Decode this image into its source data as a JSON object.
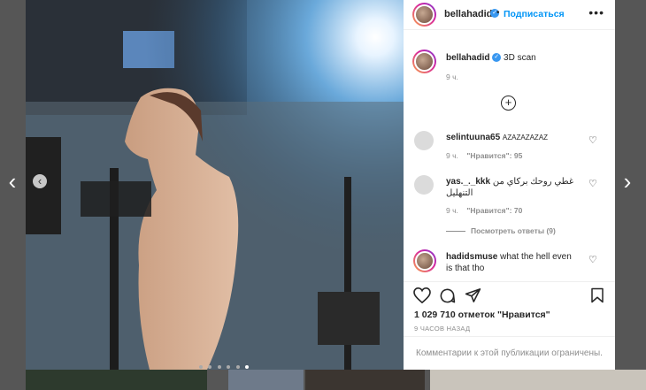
{
  "post": {
    "username": "bellahadid",
    "follow_label": "Подписаться",
    "separator": "•",
    "more_label": "•••",
    "caption": "3D scan",
    "caption_time": "9 ч.",
    "add_label": "+",
    "likes": "1 029 710 отметок \"Нравится\"",
    "posted_ago": "9 ЧАСОВ НАЗАД",
    "comments_closed": "Комментарии к этой публикации ограничены."
  },
  "comments": [
    {
      "user": "selintuuna65",
      "text": "AZAZAZAZAZ",
      "time": "9 ч.",
      "likes": "\"Нравится\": 95"
    },
    {
      "user": "yas._._kkk",
      "text": "غطي روحك بركاي من التنهليل",
      "time": "9 ч.",
      "likes": "\"Нравится\": 70",
      "replies": "Посмотреть ответы (9)"
    },
    {
      "user": "hadidsmuse",
      "text": "what the hell even is that tho"
    }
  ],
  "carousel": {
    "prev": "‹",
    "next": "›",
    "inner_prev": "‹",
    "dots_total": 6,
    "active_dot": 5
  },
  "icons": [
    "heart-icon",
    "comment-icon",
    "share-icon",
    "bookmark-icon",
    "more-icon",
    "verified-icon",
    "add-circle-icon"
  ],
  "colors": {
    "link": "#0095f6",
    "verified": "#3897f0",
    "backdrop": "#565656"
  }
}
